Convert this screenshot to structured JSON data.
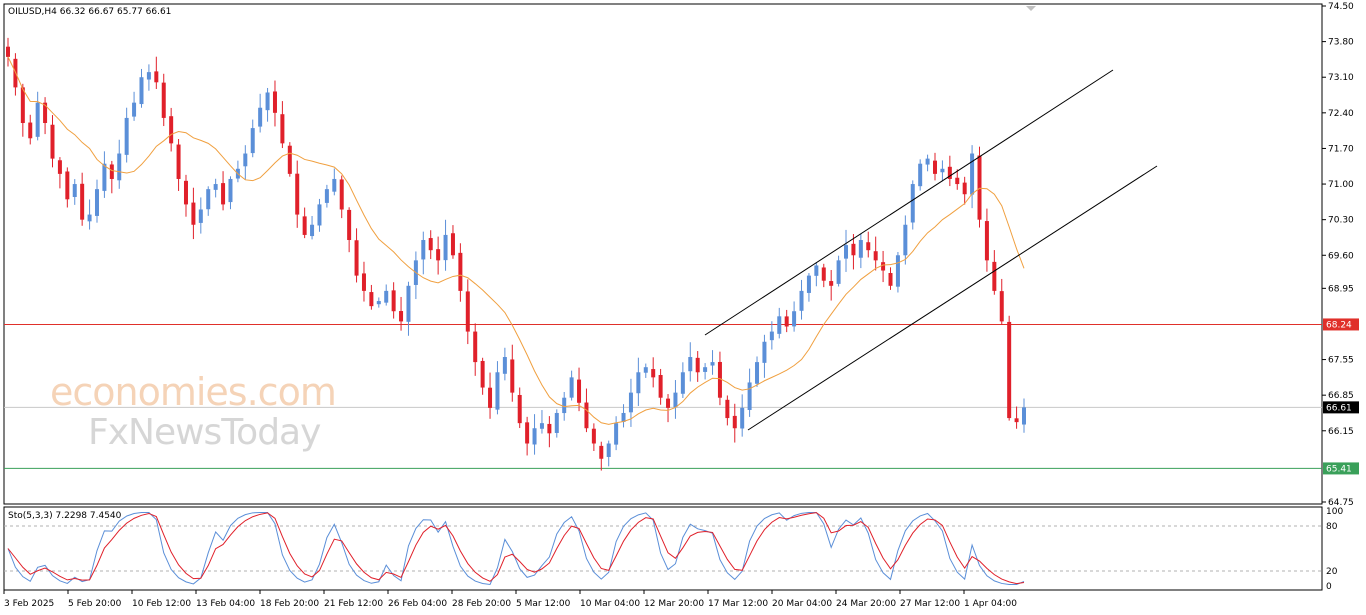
{
  "chart_data": [
    {
      "type": "candlestick",
      "title": "OILUSD,H4  66.32 66.67 65.77 66.61",
      "timeframe": "H4",
      "symbol": "OILUSD",
      "ohlc_last": {
        "open": 66.32,
        "high": 66.67,
        "low": 65.77,
        "close": 66.61
      },
      "ylim": [
        64.75,
        74.5
      ],
      "y_ticks": [
        "74.50",
        "73.80",
        "73.10",
        "72.40",
        "71.70",
        "71.00",
        "70.30",
        "69.60",
        "68.95",
        "68.24",
        "67.55",
        "66.85",
        "66.61",
        "66.15",
        "65.41",
        "64.75"
      ],
      "x_ticks": [
        "3 Feb 2025",
        "5 Feb 20:00",
        "10 Feb 12:00",
        "13 Feb 04:00",
        "18 Feb 20:00",
        "21 Feb 12:00",
        "26 Feb 04:00",
        "28 Feb 20:00",
        "5 Mar 12:00",
        "10 Mar 04:00",
        "12 Mar 20:00",
        "17 Mar 12:00",
        "20 Mar 04:00",
        "24 Mar 20:00",
        "27 Mar 12:00",
        "1 Apr 04:00"
      ],
      "horizontal_lines": [
        {
          "label": "68.24",
          "value": 68.24,
          "color": "#e0302a"
        },
        {
          "label": "66.61",
          "value": 66.61,
          "color": "#c8c8c8"
        },
        {
          "label": "65.41",
          "value": 65.41,
          "color": "#3aa05a"
        }
      ],
      "price_tag_last": "66.61",
      "moving_average_color": "#f0a040",
      "up_color": "#5b8fd8",
      "down_color": "#e0202a",
      "closes": [
        73.5,
        72.9,
        72.2,
        71.9,
        72.6,
        72.2,
        71.5,
        71.2,
        70.7,
        71.0,
        70.3,
        70.4,
        70.9,
        71.4,
        71.1,
        71.6,
        72.3,
        72.6,
        73.1,
        73.2,
        73.0,
        72.3,
        71.8,
        71.1,
        70.6,
        70.2,
        70.5,
        70.9,
        71.0,
        70.6,
        71.1,
        71.3,
        71.6,
        72.1,
        72.5,
        72.8,
        72.4,
        71.8,
        71.2,
        70.4,
        70.0,
        70.2,
        70.6,
        70.9,
        71.1,
        70.5,
        69.9,
        69.2,
        68.9,
        68.6,
        68.7,
        68.9,
        68.5,
        68.3,
        69.0,
        69.5,
        69.9,
        69.7,
        69.5,
        70.0,
        69.6,
        68.9,
        68.1,
        67.5,
        67.0,
        66.6,
        67.3,
        67.6,
        66.9,
        66.3,
        65.9,
        66.2,
        66.3,
        66.1,
        66.5,
        66.8,
        67.2,
        66.7,
        66.2,
        65.9,
        65.6,
        65.9,
        66.3,
        66.5,
        66.9,
        67.3,
        67.4,
        67.2,
        66.8,
        66.6,
        66.9,
        67.3,
        67.6,
        67.3,
        67.4,
        67.5,
        66.8,
        66.4,
        66.2,
        66.6,
        67.1,
        67.5,
        67.9,
        68.1,
        68.4,
        68.2,
        68.5,
        68.9,
        69.2,
        69.4,
        69.1,
        69.0,
        69.5,
        69.8,
        69.6,
        69.9,
        69.7,
        69.5,
        69.3,
        69.0,
        69.6,
        70.2,
        71.0,
        71.4,
        71.5,
        71.2,
        71.3,
        71.1,
        71.0,
        70.8,
        71.6,
        70.3,
        69.5,
        68.9,
        68.3,
        66.4,
        66.32,
        66.61
      ],
      "stochastic": {
        "name": "Sto(5,3,3)",
        "main": 7.2298,
        "signal": 7.454,
        "levels": [
          80,
          20
        ],
        "ylim": [
          0,
          100
        ],
        "y_ticks": [
          "100",
          "80",
          "20",
          "0"
        ],
        "main_color": "#5b8fd8",
        "signal_color": "#e0202a"
      }
    }
  ],
  "header": {
    "label": "OILUSD,H4  66.32 66.67 65.77 66.61"
  },
  "indicator": {
    "label": "Sto(5,3,3) 7.2298 7.4540"
  },
  "watermark": {
    "line1": "economies.com",
    "line2": "FxNewsToday"
  }
}
